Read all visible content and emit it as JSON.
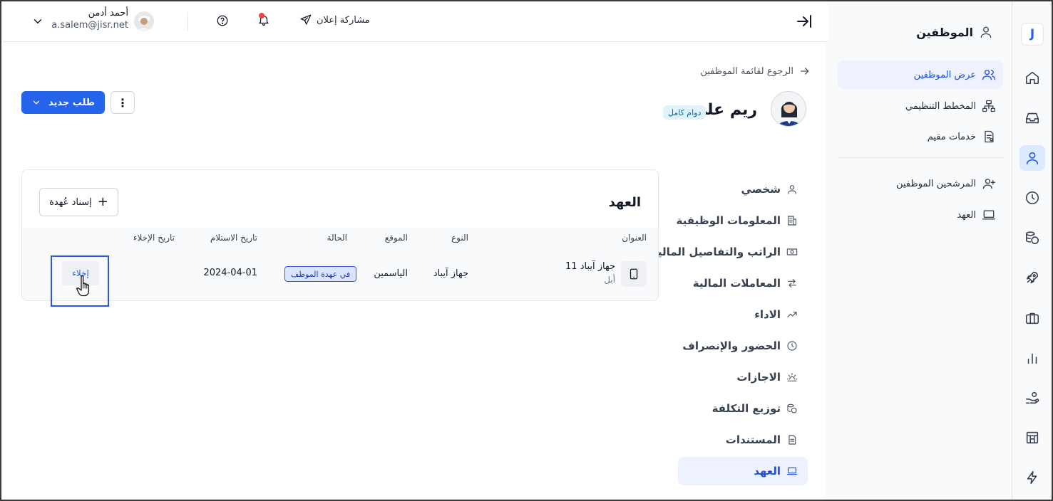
{
  "app": {
    "logo_letter": "J",
    "accent": "#2563eb"
  },
  "rail": {
    "items": [
      {
        "icon": "home-icon"
      },
      {
        "icon": "inbox-icon"
      },
      {
        "icon": "person-icon",
        "active": true
      },
      {
        "icon": "clock-icon"
      },
      {
        "icon": "coins-icon"
      },
      {
        "icon": "rocket-icon"
      },
      {
        "icon": "briefcase-icon"
      },
      {
        "icon": "bar-chart-icon"
      },
      {
        "icon": "hand-coin-icon"
      },
      {
        "icon": "store-icon"
      },
      {
        "icon": "bolt-icon"
      }
    ]
  },
  "sidebar": {
    "title": "الموظفين",
    "items": [
      {
        "label": "عرض الموظفين",
        "icon": "users-icon",
        "active": true
      },
      {
        "label": "المخطط التنظيمي",
        "icon": "org-chart-icon"
      },
      {
        "label": "خدمات مقيم",
        "icon": "document-icon"
      },
      {
        "label": "المرشحين الموظفين",
        "icon": "user-plus-icon"
      },
      {
        "label": "العهد",
        "icon": "laptop-icon"
      }
    ]
  },
  "topbar": {
    "share_label": "مشاركة إعلان",
    "user_name": "أحمد أدمن",
    "user_email": "a.salem@jisr.net"
  },
  "header": {
    "back_label": "الرجوع لقائمة الموظفين",
    "employee_name": "ريم علي",
    "employment_badge": "دوام كامل",
    "new_request_label": "طلب جديد",
    "more_label": "⋮"
  },
  "profile_tabs": [
    {
      "label": "شخصي",
      "icon": "person-icon"
    },
    {
      "label": "المعلومات الوظيفية",
      "icon": "building-icon"
    },
    {
      "label": "الراتب والتفاصيل المالية",
      "icon": "cash-icon"
    },
    {
      "label": "المعاملات المالية",
      "icon": "arrows-icon"
    },
    {
      "label": "الاداء",
      "icon": "trend-icon"
    },
    {
      "label": "الحضور والإنصراف",
      "icon": "clock-icon"
    },
    {
      "label": "الاجازات",
      "icon": "sun-icon"
    },
    {
      "label": "توزيع التكلفة",
      "icon": "coins-icon"
    },
    {
      "label": "المستندات",
      "icon": "file-icon"
    },
    {
      "label": "العهد",
      "icon": "laptop-icon",
      "active": true
    }
  ],
  "custody": {
    "title": "العهد",
    "assign_label": "إسناد عُهدة",
    "columns": {
      "title": "العنوان",
      "type": "النوع",
      "location": "الموقع",
      "status": "الحالة",
      "received_date": "تاريخ الاستلام",
      "release_date": "تاريخ الإخلاء"
    },
    "rows": [
      {
        "name": "جهاز آيباد 11",
        "brand": "أبل",
        "type": "جهاز آيباد",
        "location": "الياسمين",
        "status": "في عهدة الموظف",
        "received_date": "2024-04-01",
        "release_date": "",
        "action_label": "إخلاء"
      }
    ]
  }
}
